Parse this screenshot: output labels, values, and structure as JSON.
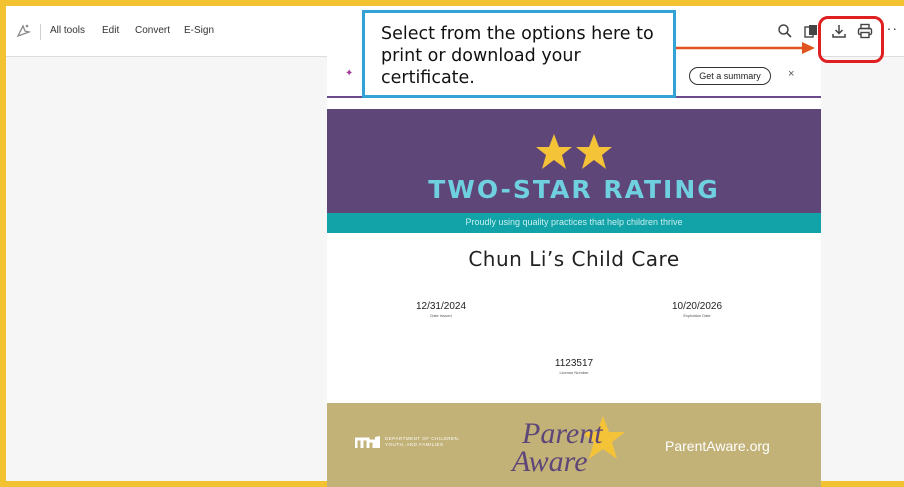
{
  "toolbar": {
    "menu": [
      "All tools",
      "Edit",
      "Convert",
      "E-Sign"
    ],
    "more_label": "···",
    "icons": [
      "ai-assistant-icon",
      "search-icon",
      "copy-icon",
      "download-icon",
      "print-icon"
    ]
  },
  "summary_bar": {
    "button_label": "Get a summary",
    "close_label": "×"
  },
  "certificate": {
    "rating_title": "TWO-STAR RATING",
    "tagline": "Proudly using quality practices that help children thrive",
    "provider_name": "Chun Li’s Child Care",
    "date_issued": {
      "value": "12/31/2024",
      "label": "Date Issued"
    },
    "expiration_date": {
      "value": "10/20/2026",
      "label": "Expiration Date"
    },
    "license_number": {
      "value": "1123517",
      "label": "License Number"
    },
    "department": "DEPARTMENT OF CHILDREN, YOUTH, AND FAMILIES",
    "logo_line1": "Parent",
    "logo_line2": "Aware",
    "website": "ParentAware.org",
    "colors": {
      "purple": "#5e4679",
      "teal": "#11a3a8",
      "gold": "#c2b277",
      "star": "#f5c338"
    }
  },
  "callout": {
    "text": "Select from the options here to print or download your certificate.",
    "border_color": "#33a3d6",
    "arrow_color": "#e0521e",
    "highlight_color": "#e02020"
  }
}
